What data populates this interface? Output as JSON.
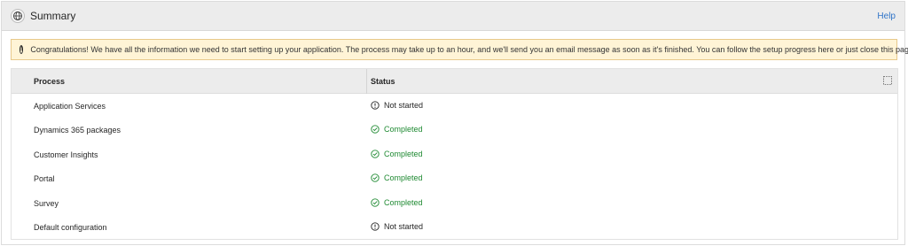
{
  "header": {
    "title": "Summary",
    "help_label": "Help"
  },
  "banner": {
    "icon": "info-icon",
    "text": "Congratulations! We have all the information we need to start setting up your application. The process may take up to an hour, and we'll send you an email message as soon as it's finished. You can follow the setup progress here or just close this page."
  },
  "table": {
    "columns": {
      "process": "Process",
      "status": "Status"
    },
    "rows": [
      {
        "process": "Application Services",
        "status": "Not started",
        "state": "notstarted"
      },
      {
        "process": "Dynamics 365 packages",
        "status": "Completed",
        "state": "completed"
      },
      {
        "process": "Customer Insights",
        "status": "Completed",
        "state": "completed"
      },
      {
        "process": "Portal",
        "status": "Completed",
        "state": "completed"
      },
      {
        "process": "Survey",
        "status": "Completed",
        "state": "completed"
      },
      {
        "process": "Default configuration",
        "status": "Not started",
        "state": "notstarted"
      }
    ]
  },
  "colors": {
    "completed": "#1f8a32",
    "link": "#2f74c8",
    "banner_bg": "#fff4d6"
  }
}
